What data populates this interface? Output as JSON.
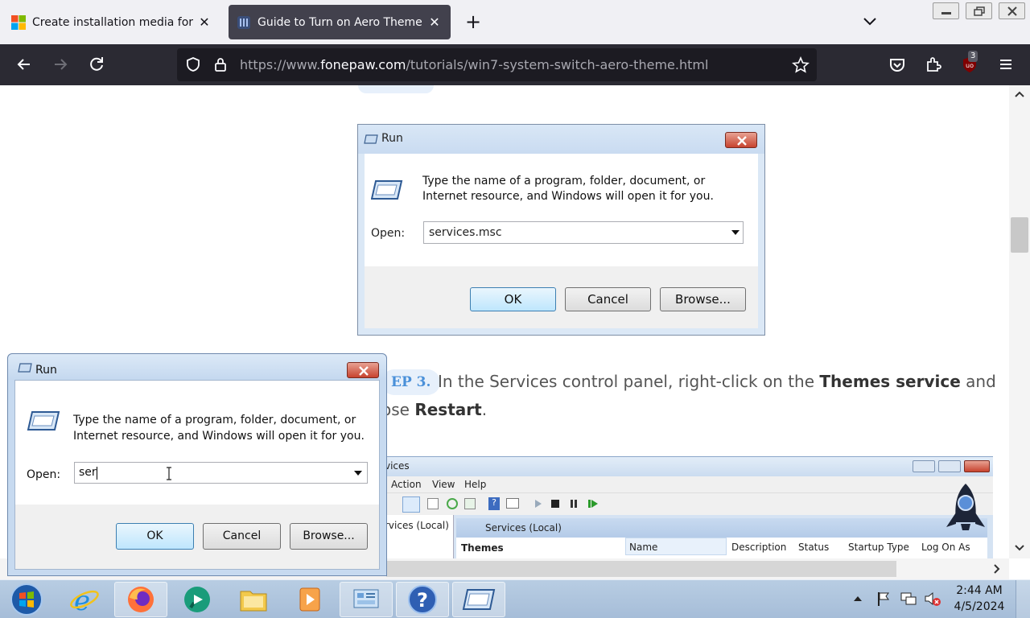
{
  "browser": {
    "tabs": [
      {
        "title": "Create installation media for Wi",
        "active": false
      },
      {
        "title": "Guide to Turn on Aero Theme o",
        "active": true
      }
    ],
    "url_prefix": "https://www.",
    "url_host": "fonepaw.com",
    "url_path": "/tutorials/win7-system-switch-aero-theme.html",
    "extension_badge": "3"
  },
  "article": {
    "image_dialog": {
      "title": "Run",
      "prompt": "Type the name of a program, folder, document, or Internet resource, and Windows will open it for you.",
      "open_label": "Open:",
      "open_value": "services.msc",
      "ok": "OK",
      "cancel": "Cancel",
      "browse": "Browse..."
    },
    "step3_label": "EP 3.",
    "step3_text_1": "In the Services control panel, right-click on the",
    "step3_bold_1": "Themes service",
    "step3_text_2": "and",
    "step3_line2_prefix": "ose",
    "step3_bold_2": "Restart",
    "step3_line2_suffix": ".",
    "services_window": {
      "title": "vices",
      "menu": [
        "Action",
        "View",
        "Help"
      ],
      "tree_item": "rvices (Local)",
      "panel_header": "Services (Local)",
      "selected_name": "Themes",
      "columns": [
        "Name",
        "Description",
        "Status",
        "Startup Type",
        "Log On As"
      ]
    }
  },
  "run_dialog": {
    "title": "Run",
    "prompt_line1": "Type the name of a program, folder, document, or",
    "prompt_line2": "Internet resource, and Windows will open it for you.",
    "open_label": "Open:",
    "open_value": "ser",
    "ok": "OK",
    "cancel": "Cancel",
    "browse": "Browse..."
  },
  "taskbar": {
    "time": "2:44 AM",
    "date": "4/5/2024",
    "apps": [
      "start-orb-icon",
      "internet-explorer-icon",
      "firefox-icon",
      "media-app-icon",
      "file-explorer-icon",
      "media-player-icon",
      "control-panel-icon",
      "help-icon",
      "run-icon"
    ]
  }
}
